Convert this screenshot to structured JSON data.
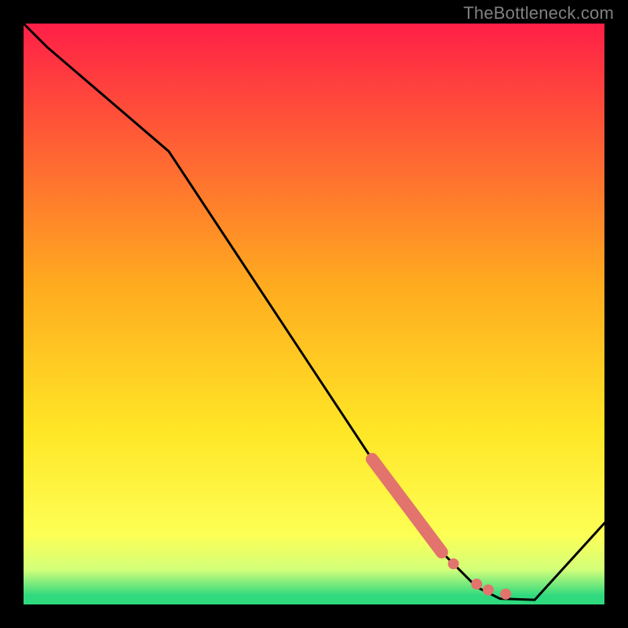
{
  "watermark": "TheBottleneck.com",
  "colors": {
    "black": "#000000",
    "line": "#000000",
    "marker": "#e2736d",
    "grad_top": "#ff1f47",
    "grad_mid1": "#ff7a2b",
    "grad_mid2": "#ffd623",
    "grad_mid3": "#fff72e",
    "grad_low": "#e9ff73",
    "grad_green": "#2fd97e",
    "watermark": "#808080"
  },
  "chart_data": {
    "type": "line",
    "title": "",
    "xlabel": "",
    "ylabel": "",
    "xlim": [
      0,
      100
    ],
    "ylim": [
      0,
      100
    ],
    "series": [
      {
        "name": "bottleneck-curve",
        "x": [
          0,
          4,
          25,
          60,
          70,
          75,
          78,
          82,
          88,
          100
        ],
        "y": [
          100,
          96,
          78,
          25,
          11,
          6,
          3,
          1,
          0.8,
          14
        ]
      }
    ],
    "highlight_segment": {
      "name": "thick-red-segment",
      "x": [
        60,
        72
      ],
      "y": [
        25,
        9
      ]
    },
    "markers": [
      {
        "name": "dot-a",
        "x": 74,
        "y": 7
      },
      {
        "name": "dot-b",
        "x": 78,
        "y": 3.5
      },
      {
        "name": "dot-c",
        "x": 80,
        "y": 2.5
      },
      {
        "name": "dot-d",
        "x": 83,
        "y": 1.8
      }
    ],
    "gradient_bands": {
      "comment": "approximate y positions (0-100 from bottom) where color transitions occur",
      "stops": [
        {
          "y": 100,
          "color": "#ff1f47"
        },
        {
          "y": 55,
          "color": "#ffab1f"
        },
        {
          "y": 30,
          "color": "#ffe626"
        },
        {
          "y": 12,
          "color": "#fdff55"
        },
        {
          "y": 6,
          "color": "#d3ff7a"
        },
        {
          "y": 1.5,
          "color": "#2fd97e"
        }
      ]
    }
  }
}
